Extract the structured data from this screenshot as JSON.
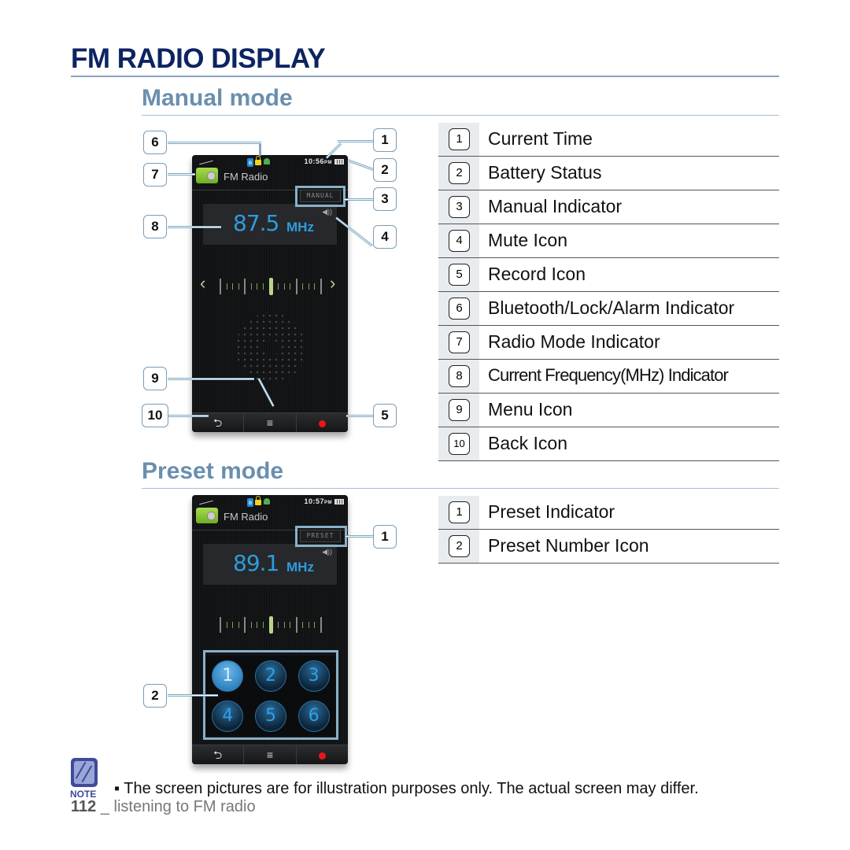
{
  "page_title": "FM RADIO DISPLAY",
  "manual_section": {
    "title": "Manual mode",
    "screen": {
      "app_name": "FM Radio",
      "time": "10:56",
      "time_suffix": "PM",
      "mode_indicator": "MANUAL",
      "frequency": "87.5",
      "unit": "MHz",
      "status_icons": [
        "bluetooth-icon",
        "lock-icon",
        "alarm-icon"
      ],
      "bottom_buttons": [
        "back-icon",
        "menu-icon",
        "record-icon"
      ]
    },
    "callouts": [
      "1",
      "2",
      "3",
      "4",
      "5",
      "6",
      "7",
      "8",
      "9",
      "10"
    ],
    "legend": [
      {
        "num": "1",
        "label": "Current Time"
      },
      {
        "num": "2",
        "label": "Battery Status"
      },
      {
        "num": "3",
        "label": "Manual Indicator"
      },
      {
        "num": "4",
        "label": "Mute Icon"
      },
      {
        "num": "5",
        "label": "Record Icon"
      },
      {
        "num": "6",
        "label": "Bluetooth/Lock/Alarm Indicator"
      },
      {
        "num": "7",
        "label": "Radio Mode Indicator"
      },
      {
        "num": "8",
        "label": "Current Frequency(MHz) Indicator"
      },
      {
        "num": "9",
        "label": "Menu Icon"
      },
      {
        "num": "10",
        "label": "Back Icon"
      }
    ]
  },
  "preset_section": {
    "title": "Preset mode",
    "screen": {
      "app_name": "FM Radio",
      "time": "10:57",
      "time_suffix": "PM",
      "mode_indicator": "PRESET",
      "frequency": "89.1",
      "unit": "MHz",
      "presets": [
        "1",
        "2",
        "3",
        "4",
        "5",
        "6"
      ],
      "active_preset": "1"
    },
    "callouts": [
      "1",
      "2"
    ],
    "legend": [
      {
        "num": "1",
        "label": "Preset Indicator"
      },
      {
        "num": "2",
        "label": "Preset Number Icon"
      }
    ]
  },
  "note": {
    "label": "NOTE",
    "text": "▪ The screen pictures are for illustration purposes only. The actual screen may differ."
  },
  "footer": {
    "page_number": "112",
    "text": " _ listening to FM radio"
  },
  "colors": {
    "title": "#0d2461",
    "section": "#6a8fae",
    "frequency": "#2f9bdc",
    "record": "#e8161b"
  }
}
